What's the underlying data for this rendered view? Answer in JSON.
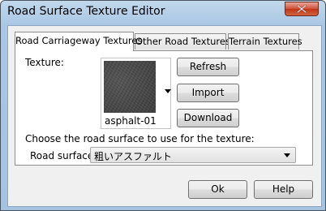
{
  "window": {
    "title": "Road Surface Texture Editor",
    "close_icon": "close-x-icon"
  },
  "tabs": [
    {
      "label": "Road Carriageway Textures",
      "active": true
    },
    {
      "label": "Other Road Textures",
      "active": false
    },
    {
      "label": "Terrain Textures",
      "active": false
    }
  ],
  "texture": {
    "label": "Texture:",
    "selected_name": "asphalt-01",
    "dropdown_icon": "dropdown-arrow-icon"
  },
  "buttons": {
    "refresh": "Refresh",
    "import": "Import",
    "download": "Download"
  },
  "surface": {
    "prompt": "Choose the road surface to use for the texture:",
    "label": "Road surface",
    "selected_value": "粗いアスファルト",
    "dropdown_icon": "dropdown-arrow-icon"
  },
  "footer": {
    "ok": "Ok",
    "help": "Help"
  },
  "colors": {
    "close_button": "#c7432a",
    "titlebar": "#a9c7e4",
    "panel_bg": "#ffffff",
    "dialog_bg": "#f0f0f0"
  }
}
